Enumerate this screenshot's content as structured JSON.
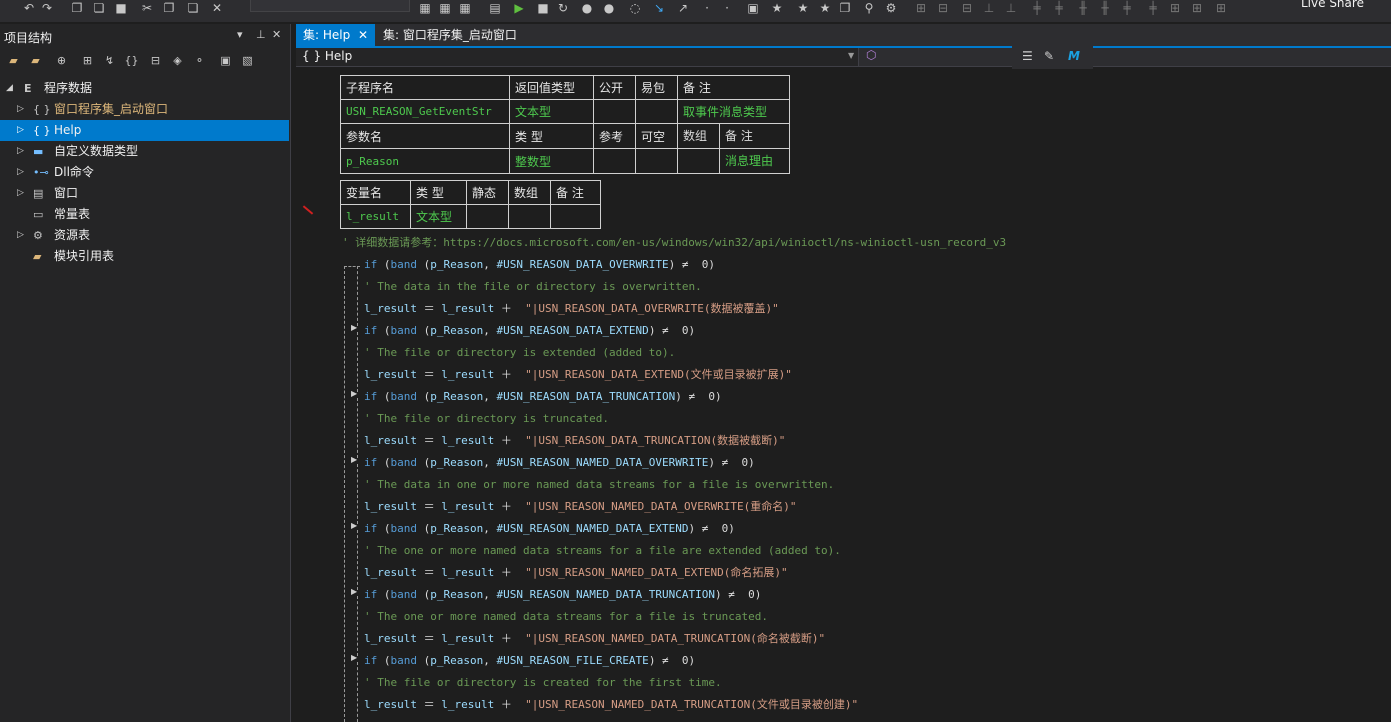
{
  "toolbar": {
    "live_share": "Live Share"
  },
  "left_panel": {
    "title": "项目结构",
    "pin_icon": "▾",
    "tree": [
      {
        "label": "程序数据",
        "icon": "program-data-icon"
      },
      {
        "label": "窗口程序集_启动窗口",
        "icon": "braces-icon"
      },
      {
        "label": "Help",
        "icon": "braces-icon"
      },
      {
        "label": "自定义数据类型",
        "icon": "data-type-icon"
      },
      {
        "label": "Dll命令",
        "icon": "dll-icon"
      },
      {
        "label": "窗口",
        "icon": "window-icon"
      },
      {
        "label": "常量表",
        "icon": "constant-icon"
      },
      {
        "label": "资源表",
        "icon": "resource-icon"
      },
      {
        "label": "模块引用表",
        "icon": "module-icon"
      }
    ]
  },
  "tabs": [
    {
      "label": "集: Help",
      "active": true
    },
    {
      "label": "集: 窗口程序集_启动窗口",
      "active": false
    }
  ],
  "nav": {
    "label": "{ } Help"
  },
  "sub_table": {
    "headers": [
      "子程序名",
      "返回值类型",
      "公开",
      "易包",
      "备 注"
    ],
    "row": [
      "USN_REASON_GetEventStr",
      "文本型",
      "",
      "",
      "取事件消息类型"
    ]
  },
  "param_table": {
    "headers": [
      "参数名",
      "类 型",
      "参考",
      "可空",
      "数组",
      "备 注"
    ],
    "row": [
      "p_Reason",
      "整数型",
      "",
      "",
      "",
      "消息理由"
    ]
  },
  "var_table": {
    "headers": [
      "变量名",
      "类 型",
      "静态",
      "数组",
      "备 注"
    ],
    "row": [
      "l_result",
      "文本型",
      "",
      "",
      ""
    ]
  },
  "code": {
    "top_comment": "' 详细数据请参考：https://docs.microsoft.com/en-us/windows/win32/api/winioctl/ns-winioctl-usn_record_v3",
    "blocks": [
      {
        "const": "#USN_REASON_DATA_OVERWRITE",
        "comment": "' The data in the file or directory is overwritten.",
        "str": "\"|USN_REASON_DATA_OVERWRITE(数据被覆盖)\""
      },
      {
        "const": "#USN_REASON_DATA_EXTEND",
        "comment": "' The file or directory is extended (added to).",
        "str": "\"|USN_REASON_DATA_EXTEND(文件或目录被扩展)\""
      },
      {
        "const": "#USN_REASON_DATA_TRUNCATION",
        "comment": "' The file or directory is truncated.",
        "str": "\"|USN_REASON_DATA_TRUNCATION(数据被截断)\""
      },
      {
        "const": "#USN_REASON_NAMED_DATA_OVERWRITE",
        "comment": "' The data in one or more named data streams for a file is overwritten.",
        "str": "\"|USN_REASON_NAMED_DATA_OVERWRITE(重命名)\""
      },
      {
        "const": "#USN_REASON_NAMED_DATA_EXTEND",
        "comment": "' The one or more named data streams for a file are extended (added to).",
        "str": "\"|USN_REASON_NAMED_DATA_EXTEND(命名拓展)\""
      },
      {
        "const": "#USN_REASON_NAMED_DATA_TRUNCATION",
        "comment": "' The one or more named data streams for a file is truncated.",
        "str": "\"|USN_REASON_NAMED_DATA_TRUNCATION(命名被截断)\""
      },
      {
        "const": "#USN_REASON_FILE_CREATE",
        "comment": "' The file or directory is created for the first time.",
        "str": "\"|USN_REASON_NAMED_DATA_TRUNCATION(文件或目录被创建)\""
      }
    ]
  },
  "colors": {
    "accent": "#007acc",
    "keyword": "#569cd6",
    "comment": "#6a9955",
    "string": "#d69d85",
    "type": "#4ec94e"
  }
}
